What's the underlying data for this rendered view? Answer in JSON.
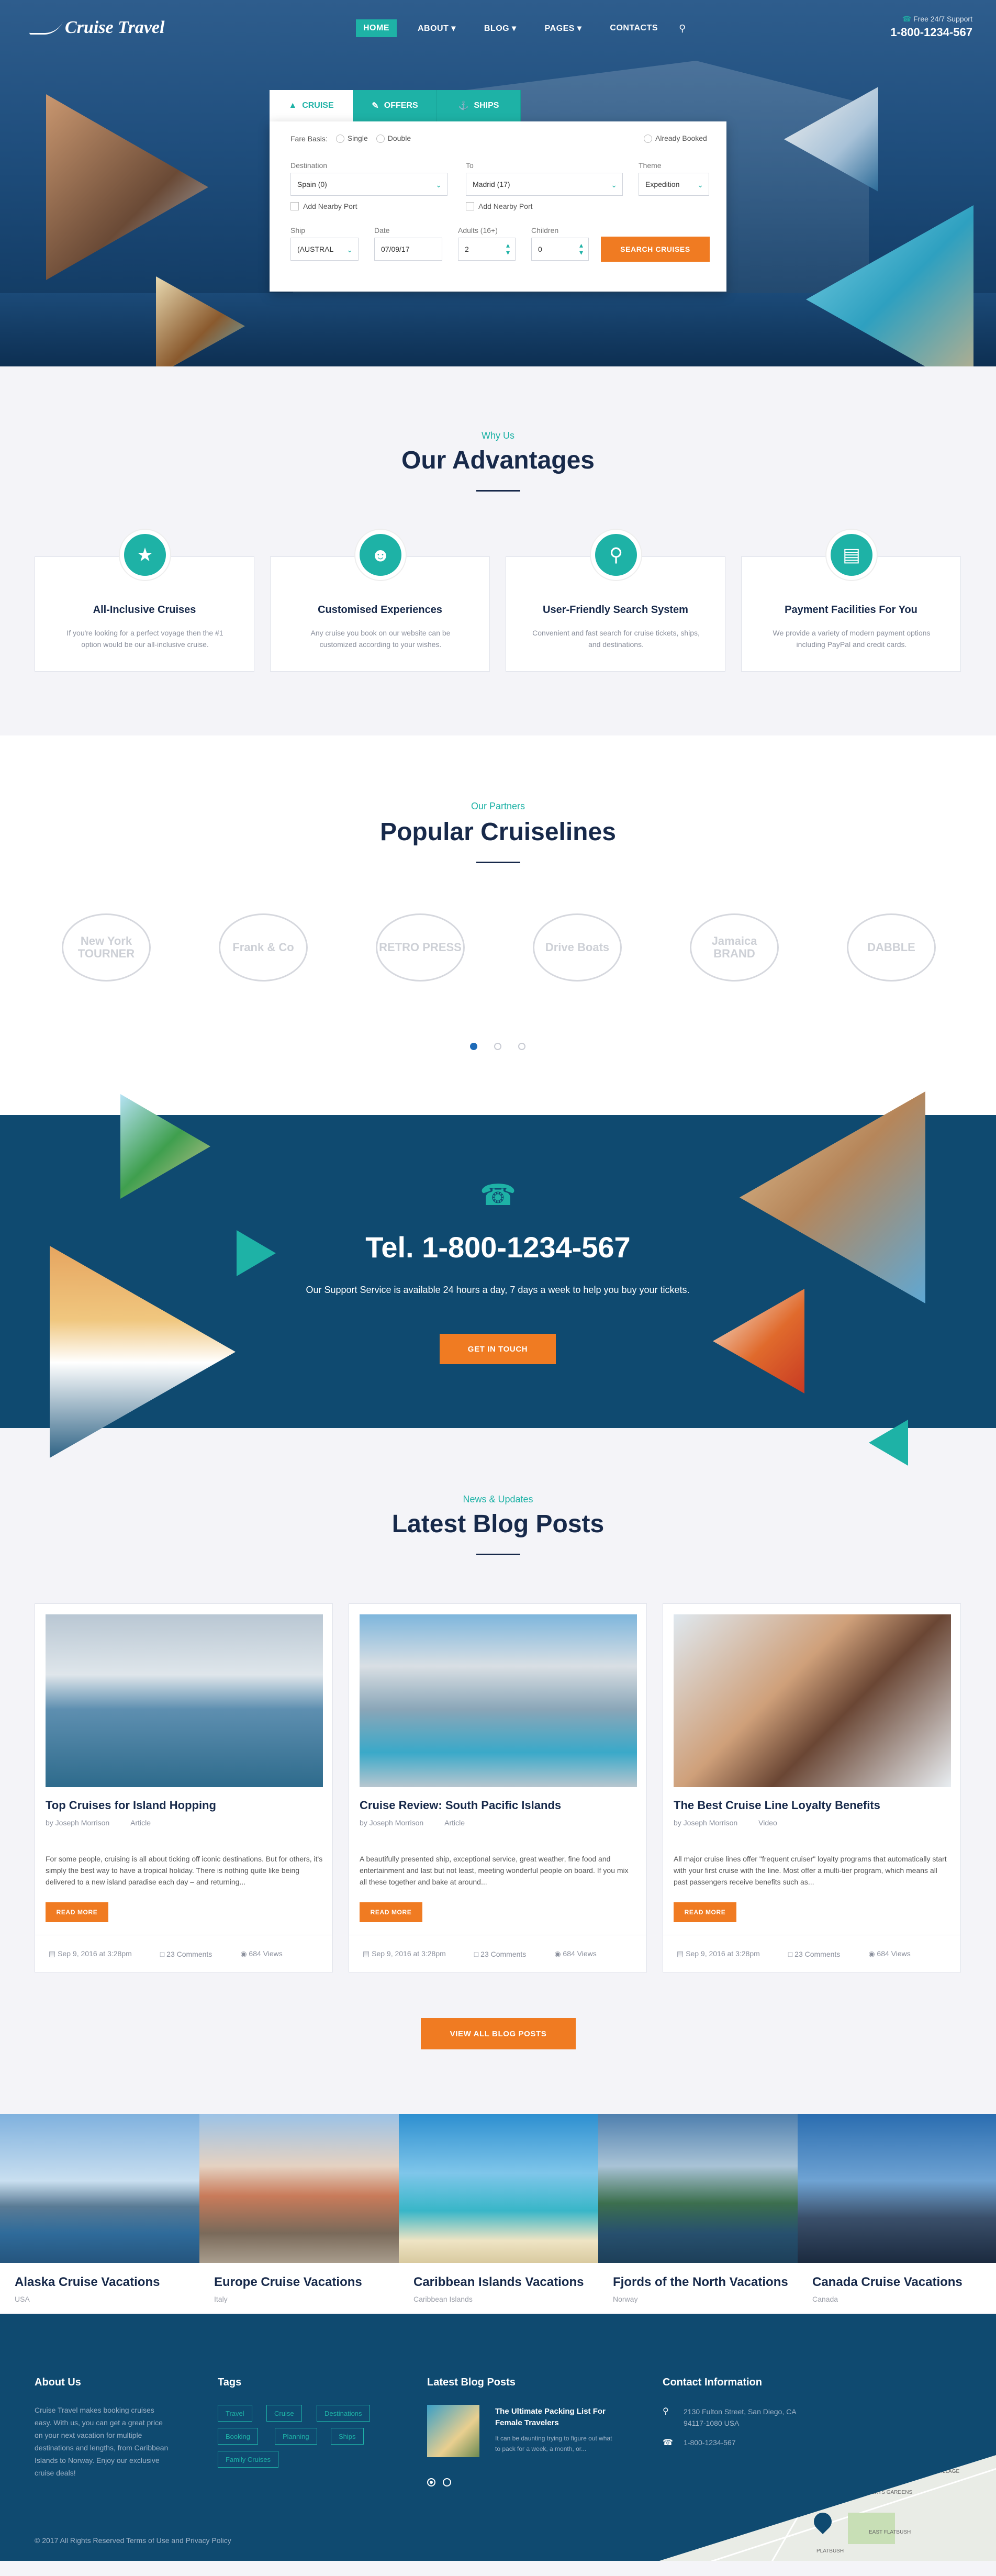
{
  "header": {
    "logo_text": "Cruise Travel",
    "nav": [
      {
        "label": "HOME"
      },
      {
        "label": "ABOUT"
      },
      {
        "label": "BLOG"
      },
      {
        "label": "PAGES"
      },
      {
        "label": "CONTACTS"
      }
    ],
    "support_label": "Free 24/7 Support",
    "support_phone": "1-800-1234-567"
  },
  "search": {
    "tabs": [
      {
        "label": "CRUISE"
      },
      {
        "label": "OFFERS"
      },
      {
        "label": "SHIPS"
      }
    ],
    "fare_label": "Fare Basis:",
    "fare_options": [
      "Single",
      "Double"
    ],
    "already_booked": "Already Booked",
    "destination_label": "Destination",
    "destination_value": "Spain (0)",
    "to_label": "To",
    "to_value": "Madrid (17)",
    "theme_label": "Theme",
    "theme_value": "Expedition",
    "nearby1": "Add Nearby Port",
    "nearby2": "Add Nearby Port",
    "ship_label": "Ship",
    "ship_value": "(AUSTRAL",
    "date_label": "Date",
    "date_value": "07/09/17",
    "adults_label": "Adults (16+)",
    "adults_value": "2",
    "children_label": "Children",
    "children_value": "0",
    "submit": "SEARCH CRUISES"
  },
  "advantages": {
    "kicker": "Why Us",
    "title": "Our Advantages",
    "items": [
      {
        "title": "All-Inclusive Cruises",
        "text": "If you're looking for a perfect voyage then the #1 option would be our all-inclusive cruise.",
        "icon": "star-icon"
      },
      {
        "title": "Customised Experiences",
        "text": "Any cruise you book on our website can be customized according to your wishes.",
        "icon": "users-icon"
      },
      {
        "title": "User-Friendly Search System",
        "text": "Convenient and fast search for cruise tickets, ships, and destinations.",
        "icon": "search-icon"
      },
      {
        "title": "Payment Facilities For You",
        "text": "We provide a variety of modern payment options including PayPal and credit cards.",
        "icon": "credit-card-icon"
      }
    ]
  },
  "partners": {
    "kicker": "Our Partners",
    "title": "Popular Cruiselines",
    "logos": [
      "New York TOURNER",
      "Frank & Co",
      "RETRO PRESS",
      "Drive Boats",
      "Jamaica BRAND",
      "DABBLE"
    ]
  },
  "support_band": {
    "phone": "Tel. 1-800-1234-567",
    "text": "Our Support Service is available 24 hours a day, 7 days a week to help you buy your tickets.",
    "button": "GET IN TOUCH"
  },
  "blog": {
    "kicker": "News & Updates",
    "title": "Latest Blog Posts",
    "posts": [
      {
        "title": "Top Cruises for Island Hopping",
        "author": "by Joseph Morrison",
        "type": "Article",
        "excerpt": "For some people, cruising is all about ticking off iconic destinations. But for others, it's simply the best way to have a tropical holiday. There is nothing quite like being delivered to a new island paradise each day – and returning...",
        "date": "Sep 9, 2016 at 3:28pm",
        "comments": "23 Comments",
        "views": "684 Views"
      },
      {
        "title": "Cruise Review: South Pacific Islands",
        "author": "by Joseph Morrison",
        "type": "Article",
        "excerpt": "A beautifully presented ship, exceptional service, great weather, fine food and entertainment and last but not least, meeting wonderful people on board. If you mix all these together and bake at around...",
        "date": "Sep 9, 2016 at 3:28pm",
        "comments": "23 Comments",
        "views": "684 Views"
      },
      {
        "title": "The Best Cruise Line Loyalty Benefits",
        "author": "by Joseph Morrison",
        "type": "Video",
        "excerpt": "All major cruise lines offer \"frequent cruiser\" loyalty programs that automatically start with your first cruise with the line. Most offer a multi-tier program, which means all past passengers receive benefits such as...",
        "date": "Sep 9, 2016 at 3:28pm",
        "comments": "23 Comments",
        "views": "684 Views"
      }
    ],
    "read_more": "READ MORE",
    "view_all": "VIEW ALL BLOG POSTS"
  },
  "destinations": [
    {
      "title": "Alaska Cruise Vacations",
      "sub": "USA"
    },
    {
      "title": "Europe Cruise Vacations",
      "sub": "Italy"
    },
    {
      "title": "Caribbean Islands Vacations",
      "sub": "Caribbean Islands"
    },
    {
      "title": "Fjords of the North Vacations",
      "sub": "Norway"
    },
    {
      "title": "Canada Cruise Vacations",
      "sub": "Canada"
    }
  ],
  "footer": {
    "about_title": "About Us",
    "about_text": "Cruise Travel makes booking cruises easy. With us, you can get a great price on your next vacation for multiple destinations and lengths, from Caribbean Islands to Norway. Enjoy our exclusive cruise deals!",
    "tags_title": "Tags",
    "tags": [
      "Travel",
      "Cruise",
      "Destinations",
      "Booking",
      "Planning",
      "Ships",
      "Family Cruises"
    ],
    "posts_title": "Latest Blog Posts",
    "post_title": "The Ultimate Packing List For Female Travelers",
    "post_text": "It can be daunting trying to figure out what to pack for a week, a month, or...",
    "contact_title": "Contact Information",
    "address": "2130 Fulton Street, San Diego, CA 94117-1080 USA",
    "phone": "1-800-1234-567",
    "copyright": "© 2017 All Rights Reserved Terms of Use and Privacy Policy",
    "map_labels": [
      "WEST VILLAGE",
      "EAST FLATBUSH",
      "PLATBUSH",
      "LEFFERTS GARDENS"
    ]
  }
}
